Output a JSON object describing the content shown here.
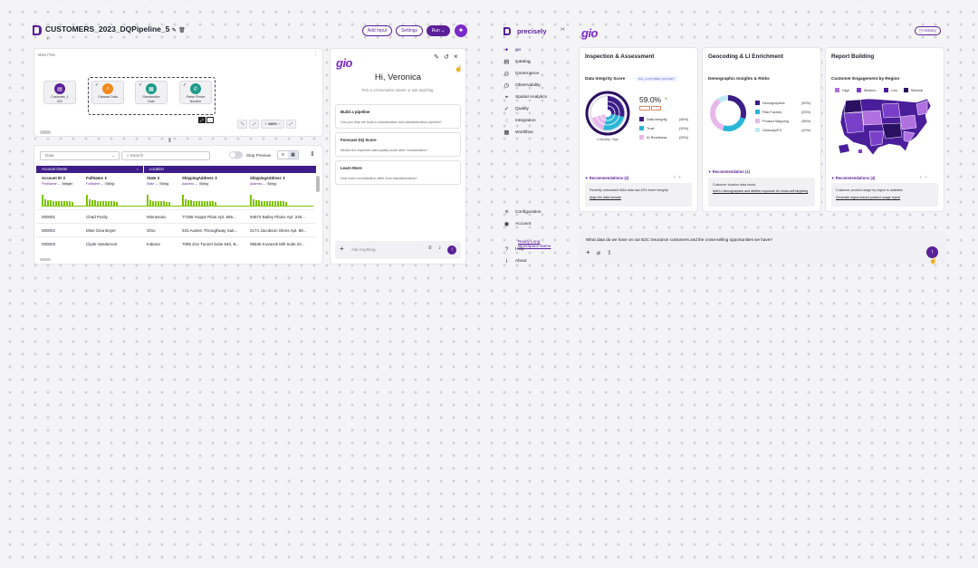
{
  "left": {
    "pipeline_title": "CUSTOMERS_2023_DQPipeline_5",
    "buttons": {
      "add_input": "Add Input",
      "settings": "Settings",
      "run": "Run"
    },
    "flow_label": "Main Flow",
    "nodes": [
      {
        "label": "Customer_1\n022",
        "color": "#5b1f9a"
      },
      {
        "label": "Cleanse Data",
        "color": "#f08a1c"
      },
      {
        "label": "Standardize\nDate",
        "color": "#1f9a8a"
      },
      {
        "label": "Parse Phone\nNumber",
        "color": "#1f9a8a"
      }
    ],
    "zoom": "100%",
    "table": {
      "select_value": "Data",
      "search_placeholder": "Search",
      "stop_preview": "Stop Preview",
      "groups": [
        "Account Owner",
        "Location"
      ],
      "columns": [
        {
          "name": "Account ID",
          "sub": "FirstName",
          "type": "Integer"
        },
        {
          "name": "FullName",
          "sub": "FullName",
          "type": "String"
        },
        {
          "name": "State",
          "sub": "State",
          "type": "String"
        },
        {
          "name": "ShippingAddress",
          "sub": "Address",
          "type": "String"
        },
        {
          "name": "ShippingAddress",
          "sub": "Address",
          "type": "String"
        }
      ],
      "rows": [
        [
          "000001",
          "Chad Purdy",
          "Minnesota",
          "77285 Hoppe Plain Apt. 655...",
          "94574 Bailey Plains Apt. 245..."
        ],
        [
          "000002",
          "Miss Gina Boyer",
          "Ohio",
          "931 Austen Throughway Suit...",
          "2174 Jacobson Glens Apt. 88..."
        ],
        [
          "000003",
          "Clyde Vandervort",
          "Indiana",
          "7095 Zoe Tunnel Suite 640, B...",
          "05846 Kovacek Mill Suite 22..."
        ]
      ]
    },
    "chat": {
      "logo": "gio",
      "greeting": "Hi, Veronica",
      "subtitle": "Pick a conversation starter or ask anything.",
      "suggestions": [
        {
          "title": "Build a pipeline",
          "text": "Can you help me build a normalization and standardization pipeline?"
        },
        {
          "title": "Forecast DQ Score",
          "text": "What's the expected data quality score after normalization?"
        },
        {
          "title": "Learn More",
          "text": "How does normalization differ from standardization?"
        }
      ],
      "ask_placeholder": "Ask Anything"
    }
  },
  "right": {
    "brand": "precisely",
    "gio_logo": "gio",
    "history": "History",
    "nav": [
      {
        "label": "gio",
        "icon": "sparkle-icon",
        "glyph": "✦"
      },
      {
        "label": "Catalog",
        "icon": "catalog-icon",
        "glyph": "▤"
      },
      {
        "label": "Governance",
        "icon": "governance-icon",
        "glyph": "◎"
      },
      {
        "label": "Observability",
        "icon": "observability-icon",
        "glyph": "◷"
      },
      {
        "label": "Spatial Analytics",
        "icon": "location-icon",
        "glyph": "⌖"
      },
      {
        "label": "Quality",
        "icon": "quality-icon",
        "glyph": "✓"
      },
      {
        "label": "Integration",
        "icon": "integration-icon",
        "glyph": "◌"
      },
      {
        "label": "Workflow",
        "icon": "workflow-icon",
        "glyph": "▦"
      }
    ],
    "nav_bottom": [
      {
        "label": "Configuration",
        "icon": "configuration-icon",
        "glyph": "≡"
      },
      {
        "label": "Account",
        "icon": "account-icon",
        "glyph": "◉"
      },
      {
        "label": "Help",
        "icon": "help-icon",
        "glyph": "?"
      },
      {
        "label": "About",
        "icon": "info-icon",
        "glyph": "i"
      }
    ],
    "workspace_link": "Really Long Workspace Name",
    "panels": [
      {
        "title": "Inspection & Assessment",
        "subtitle": "Data Integrity Score",
        "badge": "NFL_CUSTOMER_DATASET",
        "score": "59.0%",
        "criticality": "Criticality: High",
        "legend": [
          {
            "label": "Data Integrity",
            "value": "(45%)",
            "color": "#3d1d88"
          },
          {
            "label": "Trust",
            "value": "(30%)",
            "color": "#29b5d6"
          },
          {
            "label": "AI Readiness",
            "value": "(25%)",
            "color": "#e8b8ec"
          }
        ],
        "rec_title": "Recommendations (2)",
        "rec_text": "Recently onboarded M&A data has 43% lower integrity",
        "rec_link": "Align the data formats"
      },
      {
        "title": "Geocoding & LI Enrichment",
        "subtitle": "Demographic Insights & Risks",
        "legend": [
          {
            "label": "Demographics",
            "value": "(30%)",
            "color": "#3d1d88"
          },
          {
            "label": "Risk Factors",
            "value": "(25%)",
            "color": "#29b5d6"
          },
          {
            "label": "Product Mapping",
            "value": "(35%)",
            "color": "#e8b8ec"
          },
          {
            "label": "Glossary/PII",
            "value": "(10%)",
            "color": "#bfeaf3"
          }
        ],
        "donut": [
          30,
          25,
          35,
          10
        ],
        "rec_title": "Recommendation (1)",
        "rec_text": "Customer location data found.",
        "rec_link": "Add LI demographics and wildfire exposure for cross-sell targeting"
      },
      {
        "title": "Report Building",
        "subtitle": "Customer Engagement by Region",
        "legend": [
          {
            "label": "High",
            "color": "#b070e0"
          },
          {
            "label": "Medium",
            "color": "#7a3fc8"
          },
          {
            "label": "Low",
            "color": "#4a1d9a"
          },
          {
            "label": "Minimal",
            "color": "#2a1060"
          }
        ],
        "rec_title": "Recommendations (4)",
        "rec_text": "Customer product usage by region is available.",
        "rec_link": "Generate region-based product usage report"
      }
    ],
    "prompt_text": "What data do we have on our B2C insurance customers and the cross-selling opportunities we have?"
  }
}
